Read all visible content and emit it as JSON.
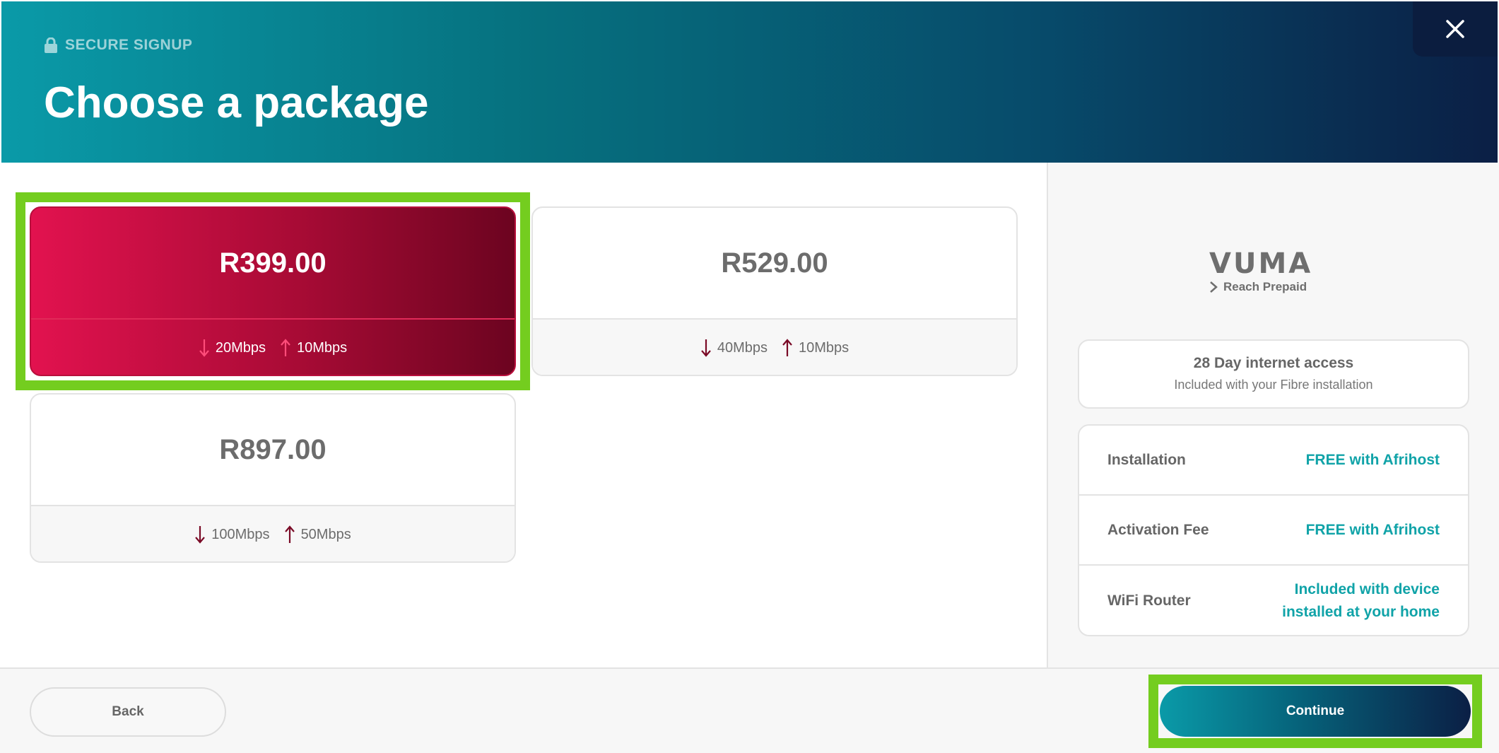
{
  "header": {
    "eyebrow": "SECURE SIGNUP",
    "title": "Choose a package"
  },
  "packages": [
    {
      "price": "R399.00",
      "download": "20Mbps",
      "upload": "10Mbps",
      "selected": true
    },
    {
      "price": "R529.00",
      "download": "40Mbps",
      "upload": "10Mbps",
      "selected": false
    },
    {
      "price": "R897.00",
      "download": "100Mbps",
      "upload": "50Mbps",
      "selected": false
    }
  ],
  "provider": {
    "name": "VUMA",
    "product": "Reach Prepaid"
  },
  "access": {
    "title": "28 Day internet access",
    "subtitle": "Included with your Fibre installation"
  },
  "fees": [
    {
      "label": "Installation",
      "value": "FREE with Afrihost"
    },
    {
      "label": "Activation Fee",
      "value": "FREE with Afrihost"
    },
    {
      "label": "WiFi Router",
      "value_line1": "Included with device",
      "value_line2": "installed at your home"
    }
  ],
  "footer": {
    "back_label": "Back",
    "continue_label": "Continue"
  },
  "colors": {
    "accent_teal": "#10a3a8",
    "selected_card": "#c20c40",
    "highlight": "#74cd1f",
    "header_dark": "#0b1f45"
  }
}
